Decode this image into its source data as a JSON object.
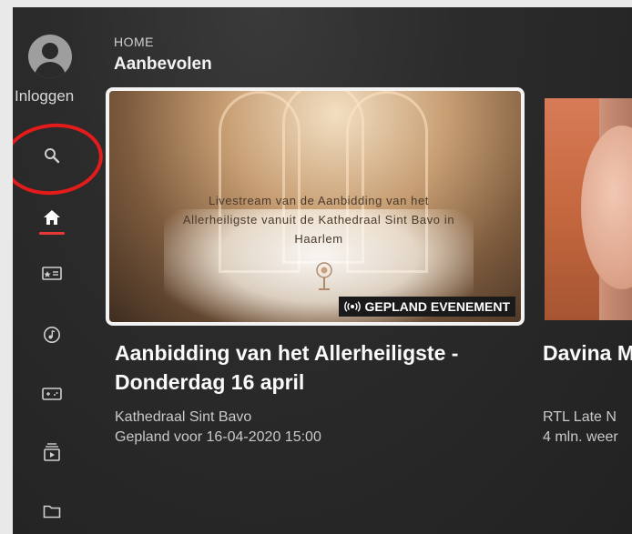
{
  "sidebar": {
    "login_label": "Inloggen",
    "items": [
      {
        "name": "search",
        "icon": "search-icon"
      },
      {
        "name": "home",
        "icon": "home-icon",
        "active": true
      },
      {
        "name": "subscriptions",
        "icon": "subscriptions-icon"
      },
      {
        "name": "music",
        "icon": "music-icon"
      },
      {
        "name": "gaming",
        "icon": "gaming-icon"
      },
      {
        "name": "queue",
        "icon": "queue-icon"
      },
      {
        "name": "library",
        "icon": "folder-icon"
      }
    ],
    "active_color": "#e53935",
    "annotation_color": "#e31b1b"
  },
  "header": {
    "section": "HOME",
    "title": "Aanbevolen"
  },
  "featured": {
    "thumbnail_caption": "Livestream van de Aanbidding van het Allerheiligste vanuit de Kathedraal Sint Bavo in Haarlem",
    "badge": "GEPLAND EVENEMENT",
    "title": "Aanbidding van het Allerheiligste - Donderdag 16 april",
    "channel": "Kathedraal Sint Bavo",
    "scheduled": "Gepland voor 16-04-2020 15:00"
  },
  "next_card": {
    "title": "Davina M 'Jealous",
    "channel": "RTL Late N",
    "views": "4 mln. weer"
  }
}
